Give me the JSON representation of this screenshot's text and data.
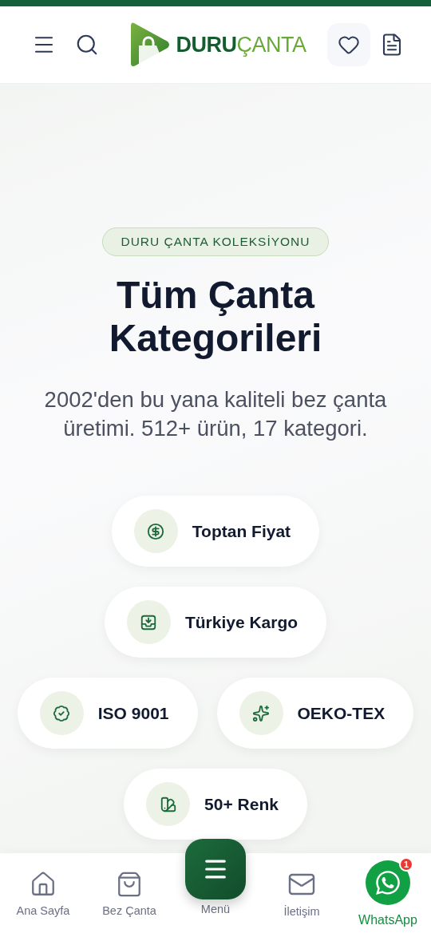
{
  "header": {
    "logo": {
      "bold": "DURU",
      "light": "ÇANTA"
    }
  },
  "hero": {
    "badge": "DURU ÇANTA KOLEKSİYONU",
    "title": "Tüm Çanta Kategorileri",
    "subtitle": "2002'den bu yana kaliteli bez çanta üretimi. 512+ ürün, 17 kategori."
  },
  "feature_rows": [
    [
      {
        "kind": "price",
        "label": "Toptan Fiyat"
      }
    ],
    [
      {
        "kind": "shipping",
        "label": "Türkiye Kargo"
      }
    ],
    [
      {
        "kind": "certified",
        "label": "ISO 9001"
      },
      {
        "kind": "sparkle",
        "label": "OEKO-TEX"
      }
    ],
    [
      {
        "kind": "colors",
        "label": "50+ Renk"
      }
    ]
  ],
  "bottom_nav": [
    {
      "kind": "home",
      "label": "Ana Sayfa"
    },
    {
      "kind": "bag",
      "label": "Bez Çanta"
    },
    {
      "kind": "menu",
      "label": "Menü"
    },
    {
      "kind": "mail",
      "label": "İletişim"
    },
    {
      "kind": "whatsapp",
      "label": "WhatsApp",
      "badge": "1"
    }
  ]
}
